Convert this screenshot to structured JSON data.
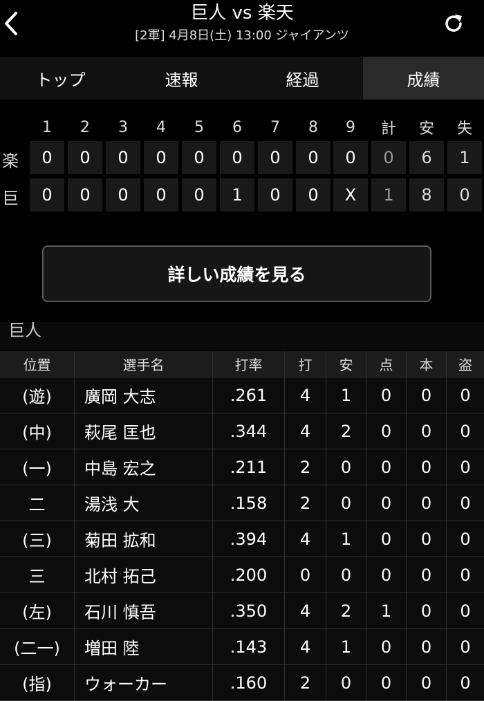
{
  "header": {
    "title": "巨人 vs 楽天",
    "subtitle": "[2軍] 4月8日(土) 13:00 ジャイアンツ"
  },
  "tabs": [
    {
      "label": "トップ"
    },
    {
      "label": "速報"
    },
    {
      "label": "経過"
    },
    {
      "label": "成績"
    }
  ],
  "scoreboard": {
    "headers": [
      "1",
      "2",
      "3",
      "4",
      "5",
      "6",
      "7",
      "8",
      "9",
      "計",
      "安",
      "失"
    ],
    "rows": [
      {
        "team": "楽",
        "cells": [
          "0",
          "0",
          "0",
          "0",
          "0",
          "0",
          "0",
          "0",
          "0",
          "0",
          "6",
          "1"
        ]
      },
      {
        "team": "巨",
        "cells": [
          "0",
          "0",
          "0",
          "0",
          "0",
          "1",
          "0",
          "0",
          "X",
          "1",
          "8",
          "0"
        ]
      }
    ]
  },
  "detail_button": {
    "label": "詳しい成績を見る"
  },
  "team_section": {
    "title": "巨人"
  },
  "stats": {
    "headers": [
      "位置",
      "選手名",
      "打率",
      "打",
      "安",
      "点",
      "本",
      "盗"
    ],
    "rows": [
      [
        "(遊)",
        "廣岡 大志",
        ".261",
        "4",
        "1",
        "0",
        "0",
        "0"
      ],
      [
        "(中)",
        "萩尾 匡也",
        ".344",
        "4",
        "2",
        "0",
        "0",
        "0"
      ],
      [
        "(一)",
        "中島 宏之",
        ".211",
        "2",
        "0",
        "0",
        "0",
        "0"
      ],
      [
        "二",
        "湯浅 大",
        ".158",
        "2",
        "0",
        "0",
        "0",
        "0"
      ],
      [
        "(三)",
        "菊田 拡和",
        ".394",
        "4",
        "1",
        "0",
        "0",
        "0"
      ],
      [
        "三",
        "北村 拓己",
        ".200",
        "0",
        "0",
        "0",
        "0",
        "0"
      ],
      [
        "(左)",
        "石川 慎吾",
        ".350",
        "4",
        "2",
        "1",
        "0",
        "0"
      ],
      [
        "(二一)",
        "増田 陸",
        ".143",
        "4",
        "1",
        "0",
        "0",
        "0"
      ],
      [
        "(指)",
        "ウォーカー",
        ".160",
        "2",
        "0",
        "0",
        "0",
        "0"
      ]
    ]
  }
}
